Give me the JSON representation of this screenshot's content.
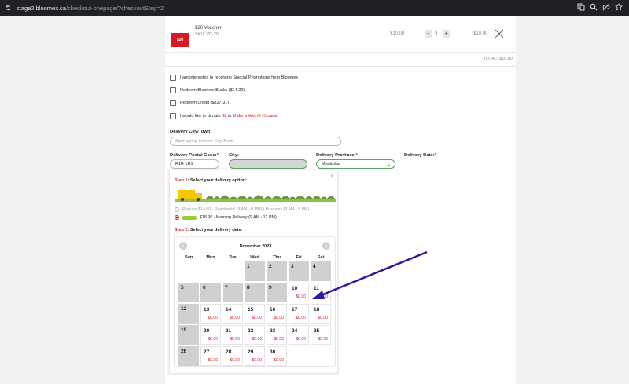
{
  "browser": {
    "url_host": "stage2.bloomex.ca",
    "url_path": "/checkout-onepage/?checkoutStep=2"
  },
  "cart": {
    "voucher_img_text": "$20",
    "item_name": "$20 Voucher",
    "item_sku": "SKU: VC-20",
    "unit_price": "$10.00",
    "qty_minus": "-",
    "quantity": "1",
    "qty_plus": "+",
    "line_total": "$10.00",
    "total": "TOTAL: $10.00"
  },
  "options": {
    "promotions": "I am interested in receiving Special Promotions from Bloomex",
    "bucks": "Redeem Bloomex Bucks ($14.22)",
    "credit": "Redeem Credit ($837.91)",
    "donate_pre": "I would like to donate ",
    "donate_amount": "$2",
    "donate_mid": " to ",
    "donate_org": "Make a Wish® Canada"
  },
  "delivery": {
    "city_town_label": "Delivery City/Town",
    "city_town_placeholder": "Start typing delivery City/Town",
    "postal_label": "Delivery Postal Code:",
    "postal_value": "R1R 1R1",
    "city_label": "City:",
    "city_value": "",
    "province_label": "Delivery Province:",
    "province_value": "Manitoba",
    "date_label": "Delivery Date:",
    "required_mark": "*"
  },
  "panel": {
    "close": "×",
    "step1_prefix": "Step 1",
    "step1_text": ": Select your delivery option:",
    "option_regular": "Regular $14.90 - Residential (9 AM - 8 PM) | Business (9 AM - 5 PM)",
    "option_morning": "$18.98 - Morning Delivery (9 AM - 12 PM)",
    "step2_prefix": "Step 2",
    "step2_text": ": Select your delivery date:"
  },
  "calendar": {
    "title": "November 2023",
    "prev": "‹",
    "next": "›",
    "weekdays": [
      "Sun",
      "Mon",
      "Tue",
      "Wed",
      "Thu",
      "Fri",
      "Sat"
    ],
    "weeks": [
      [
        {
          "d": ""
        },
        {
          "d": ""
        },
        {
          "d": ""
        },
        {
          "d": "1",
          "open": false
        },
        {
          "d": "2",
          "open": false
        },
        {
          "d": "3",
          "open": false
        },
        {
          "d": "4",
          "open": false
        }
      ],
      [
        {
          "d": "5",
          "open": false
        },
        {
          "d": "6",
          "open": false
        },
        {
          "d": "7",
          "open": false
        },
        {
          "d": "8",
          "open": false
        },
        {
          "d": "9",
          "open": false
        },
        {
          "d": "10",
          "open": true,
          "price": "$0.00"
        },
        {
          "d": "11",
          "open": true,
          "price": "$0.00"
        }
      ],
      [
        {
          "d": "12",
          "open": false
        },
        {
          "d": "13",
          "open": true,
          "price": "$0.00"
        },
        {
          "d": "14",
          "open": true,
          "price": "$0.00"
        },
        {
          "d": "15",
          "open": true,
          "price": "$0.00"
        },
        {
          "d": "16",
          "open": true,
          "price": "$0.00"
        },
        {
          "d": "17",
          "open": true,
          "price": "$0.00"
        },
        {
          "d": "18",
          "open": true,
          "price": "$0.00"
        }
      ],
      [
        {
          "d": "19",
          "open": false
        },
        {
          "d": "20",
          "open": true,
          "price": "$0.00"
        },
        {
          "d": "21",
          "open": true,
          "price": "$0.00"
        },
        {
          "d": "22",
          "open": true,
          "price": "$0.00"
        },
        {
          "d": "23",
          "open": true,
          "price": "$0.00"
        },
        {
          "d": "24",
          "open": true,
          "price": "$0.00"
        },
        {
          "d": "25",
          "open": true,
          "price": "$0.00"
        }
      ],
      [
        {
          "d": "26",
          "open": false
        },
        {
          "d": "27",
          "open": true,
          "price": "$0.00"
        },
        {
          "d": "28",
          "open": true,
          "price": "$0.00"
        },
        {
          "d": "29",
          "open": true,
          "price": "$0.00"
        },
        {
          "d": "30",
          "open": true,
          "price": "$0.00"
        },
        {
          "d": ""
        },
        {
          "d": ""
        }
      ]
    ]
  },
  "colors": {
    "brand_red": "#d71a21",
    "valid_green": "#5aa55a",
    "annotation_arrow": "#2a1aa0"
  }
}
